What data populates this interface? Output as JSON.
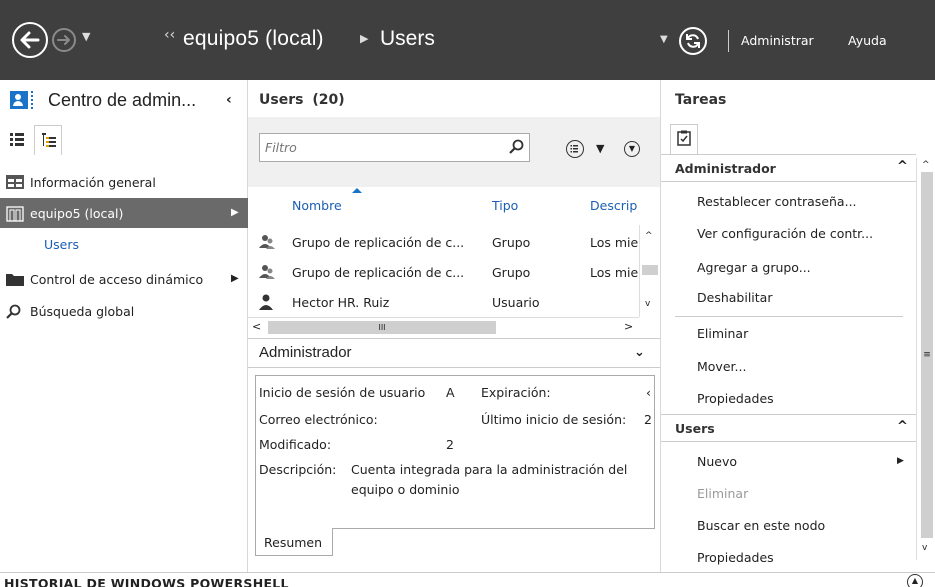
{
  "topbar": {
    "breadcrumb_root": "equipo5 (local)",
    "breadcrumb_leaf": "Users",
    "menu_admin": "Administrar",
    "menu_help": "Ayuda"
  },
  "left": {
    "title": "Centro de admin...",
    "nav": {
      "overview": "Información general",
      "equipo5": "equipo5 (local)",
      "users": "Users",
      "dac": "Control de acceso dinámico",
      "global": "Búsqueda global"
    }
  },
  "center": {
    "title": "Users",
    "count": "(20)",
    "filter_placeholder": "Filtro",
    "columns": {
      "name": "Nombre",
      "type": "Tipo",
      "desc": "Descrip"
    },
    "rows": [
      {
        "name": "Grupo de replicación de c...",
        "type": "Grupo",
        "desc": "Los mie",
        "icon": "group-icon"
      },
      {
        "name": "Grupo de replicación de c...",
        "type": "Grupo",
        "desc": "Los mie",
        "icon": "group-icon"
      },
      {
        "name": "Hector HR. Ruiz",
        "type": "Usuario",
        "desc": "",
        "icon": "user-icon"
      }
    ],
    "hscroll_thumb_label": "III",
    "detail": {
      "title": "Administrador",
      "logon_label": "Inicio de sesión de usuario",
      "logon_value": "A",
      "expiry_label": "Expiración:",
      "expiry_value": "‹",
      "email_label": "Correo electrónico:",
      "last_logon_label": "Último inicio de sesión:",
      "last_logon_value": "2",
      "modified_label": "Modificado:",
      "modified_value": "2",
      "desc_label": "Descripción:",
      "desc_line1": "Cuenta integrada para la administración del",
      "desc_line2": "equipo o dominio",
      "summary_tab": "Resumen"
    }
  },
  "right": {
    "title": "Tareas",
    "section1": "Administrador",
    "tasks1": [
      "Restablecer contraseña...",
      "Ver configuración de contr...",
      "Agregar a grupo...",
      "Deshabilitar",
      "Eliminar",
      "Mover...",
      "Propiedades"
    ],
    "section2": "Users",
    "tasks2": [
      "Nuevo",
      "Eliminar",
      "Buscar en este nodo",
      "Propiedades"
    ]
  },
  "bottom": {
    "title": "HISTORIAL DE WINDOWS POWERSHELL"
  },
  "colors": {
    "topbar_bg": "#3f3f3f",
    "selected_nav_bg": "#6a6a6a",
    "link_blue": "#1a5fb4",
    "accent_blue": "#1a73c9"
  }
}
